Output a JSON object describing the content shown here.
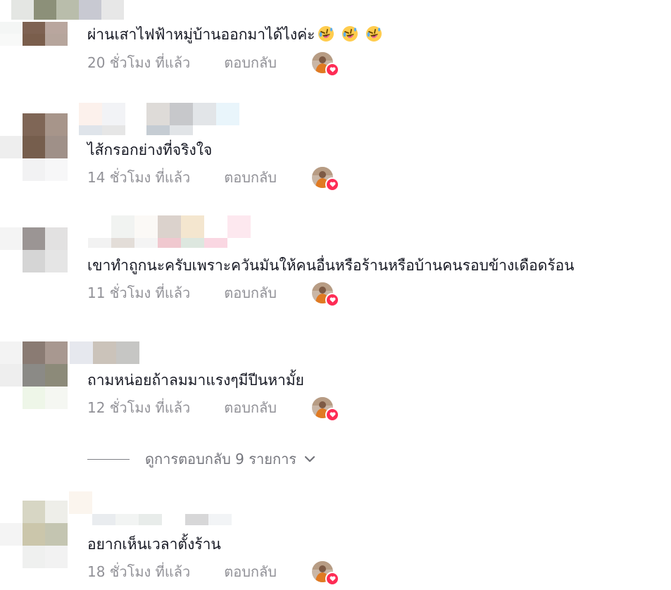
{
  "comments": [
    {
      "text": "ผ่านเสาไฟฟ้าหมู่บ้านออกมาได้ไงค่ะ",
      "emojis": [
        "rolling-laughing-emoji",
        "rolling-laughing-emoji",
        "rolling-laughing-emoji"
      ],
      "time": "20 ชั่วโมง ที่แล้ว",
      "reply": "ตอบกลับ",
      "liked_by_creator": true
    },
    {
      "text": "ไส้กรอกย่างที่จริงใจ",
      "emojis": [],
      "time": "14 ชั่วโมง ที่แล้ว",
      "reply": "ตอบกลับ",
      "liked_by_creator": true
    },
    {
      "text": "เขาทำถูกนะครับเพราะควันมันให้คนอื่นหรือร้านหรือบ้านคนรอบข้างเดือดร้อน",
      "emojis": [],
      "time": "11 ชั่วโมง ที่แล้ว",
      "reply": "ตอบกลับ",
      "liked_by_creator": true
    },
    {
      "text": "ถามหน่อยถ้าลมมาแรงๆมีปีนหามั้ย",
      "emojis": [],
      "time": "12 ชั่วโมง ที่แล้ว",
      "reply": "ตอบกลับ",
      "liked_by_creator": true
    },
    {
      "text": "อยากเห็นเวลาตั้งร้าน",
      "emojis": [],
      "time": "18 ชั่วโมง ที่แล้ว",
      "reply": "ตอบกลับ",
      "liked_by_creator": true
    }
  ],
  "view_replies": {
    "label": "ดูการตอบกลับ 9 รายการ",
    "icon": "chevron-down-icon"
  },
  "colors": {
    "primary_text": "#161823",
    "secondary_text": "#8a8b91",
    "heart_badge": "#fe2c55"
  }
}
